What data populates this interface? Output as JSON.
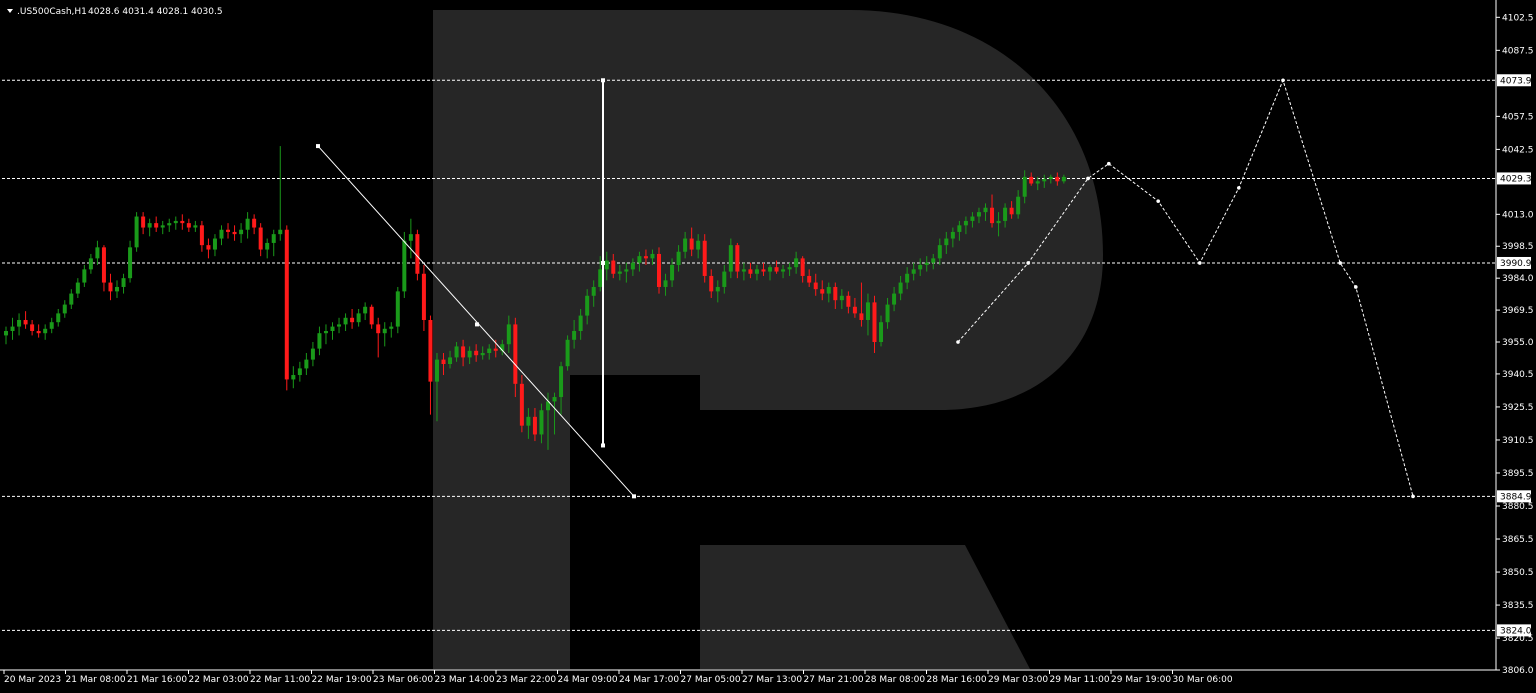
{
  "header": {
    "symbol": ".US500Cash,H1",
    "ohlc": "4028.6 4031.4 4028.1 4030.5"
  },
  "colors": {
    "background": "#000000",
    "foreground": "#ffffff",
    "bull": "#1a9a1a",
    "bear": "#ff1a1a",
    "watermark": "#262626"
  },
  "chart_data": {
    "type": "candlestick",
    "title": ".US500Cash,H1",
    "timeframe": "H1",
    "xlabel": "",
    "ylabel": "",
    "ylim": [
      3806.0,
      4109.0
    ],
    "grid": false,
    "y_ticks": [
      4102.5,
      4087.5,
      4057.5,
      4042.5,
      4013.0,
      3998.5,
      3984.0,
      3969.5,
      3955.0,
      3940.5,
      3925.5,
      3910.5,
      3895.5,
      3880.5,
      3865.5,
      3850.5,
      3835.5,
      3820.5,
      3806.0
    ],
    "x_ticks": [
      "20 Mar 2023",
      "21 Mar 08:00",
      "21 Mar 16:00",
      "22 Mar 03:00",
      "22 Mar 11:00",
      "22 Mar 19:00",
      "23 Mar 06:00",
      "23 Mar 14:00",
      "23 Mar 22:00",
      "24 Mar 09:00",
      "24 Mar 17:00",
      "27 Mar 05:00",
      "27 Mar 13:00",
      "27 Mar 21:00",
      "28 Mar 08:00",
      "28 Mar 16:00",
      "29 Mar 03:00",
      "29 Mar 11:00",
      "29 Mar 19:00",
      "30 Mar 06:00"
    ],
    "levels": [
      4073.9,
      4029.3,
      3990.9,
      3884.9,
      3824.0
    ],
    "candles": [
      [
        3958,
        3962,
        3954,
        3960
      ],
      [
        3960,
        3966,
        3956,
        3962
      ],
      [
        3962,
        3968,
        3958,
        3965
      ],
      [
        3965,
        3969,
        3961,
        3963
      ],
      [
        3963,
        3965,
        3958,
        3960
      ],
      [
        3960,
        3963,
        3957,
        3959
      ],
      [
        3959,
        3963,
        3956,
        3961
      ],
      [
        3961,
        3966,
        3959,
        3964
      ],
      [
        3964,
        3970,
        3962,
        3968
      ],
      [
        3968,
        3974,
        3966,
        3972
      ],
      [
        3972,
        3979,
        3970,
        3977
      ],
      [
        3977,
        3984,
        3975,
        3982
      ],
      [
        3982,
        3990,
        3980,
        3988
      ],
      [
        3988,
        3995,
        3986,
        3993
      ],
      [
        3993,
        4001,
        3990,
        3998
      ],
      [
        3998,
        3999,
        3978,
        3982
      ],
      [
        3982,
        3986,
        3974,
        3978
      ],
      [
        3978,
        3983,
        3975,
        3980
      ],
      [
        3980,
        3986,
        3977,
        3984
      ],
      [
        3984,
        4001,
        3982,
        3998
      ],
      [
        3998,
        4014,
        3996,
        4012
      ],
      [
        4012,
        4014,
        4004,
        4007
      ],
      [
        4007,
        4011,
        4003,
        4009
      ],
      [
        4009,
        4012,
        4005,
        4007
      ],
      [
        4007,
        4010,
        4004,
        4008
      ],
      [
        4008,
        4011,
        4005,
        4009
      ],
      [
        4009,
        4012,
        4006,
        4010
      ],
      [
        4010,
        4013,
        4006,
        4009
      ],
      [
        4009,
        4011,
        4005,
        4007
      ],
      [
        4007,
        4010,
        4005,
        4008
      ],
      [
        4008,
        4010,
        3996,
        3999
      ],
      [
        3999,
        4002,
        3993,
        3997
      ],
      [
        3997,
        4004,
        3994,
        4002
      ],
      [
        4002,
        4008,
        3999,
        4006
      ],
      [
        4006,
        4009,
        4002,
        4005
      ],
      [
        4005,
        4008,
        4001,
        4004
      ],
      [
        4004,
        4009,
        4000,
        4006
      ],
      [
        4006,
        4014,
        4002,
        4011
      ],
      [
        4011,
        4013,
        4004,
        4007
      ],
      [
        4007,
        4009,
        3994,
        3997
      ],
      [
        3997,
        4002,
        3993,
        4000
      ],
      [
        4000,
        4006,
        3994,
        4004
      ],
      [
        4004,
        4044,
        4001,
        4006
      ],
      [
        4006,
        4008,
        3933,
        3938
      ],
      [
        3938,
        3944,
        3934,
        3940
      ],
      [
        3940,
        3946,
        3937,
        3943
      ],
      [
        3943,
        3950,
        3940,
        3947
      ],
      [
        3947,
        3955,
        3944,
        3952
      ],
      [
        3952,
        3962,
        3949,
        3959
      ],
      [
        3959,
        3963,
        3954,
        3960
      ],
      [
        3960,
        3964,
        3956,
        3962
      ],
      [
        3962,
        3966,
        3959,
        3963
      ],
      [
        3963,
        3968,
        3960,
        3966
      ],
      [
        3966,
        3970,
        3961,
        3964
      ],
      [
        3964,
        3970,
        3962,
        3968
      ],
      [
        3968,
        3973,
        3965,
        3971
      ],
      [
        3971,
        3972,
        3961,
        3963
      ],
      [
        3963,
        3966,
        3948,
        3959
      ],
      [
        3959,
        3964,
        3953,
        3961
      ],
      [
        3961,
        3964,
        3957,
        3962
      ],
      [
        3962,
        3980,
        3959,
        3978
      ],
      [
        3978,
        4005,
        3975,
        4001
      ],
      [
        4001,
        4011,
        3993,
        4004
      ],
      [
        4004,
        4006,
        3983,
        3986
      ],
      [
        3986,
        3990,
        3960,
        3965
      ],
      [
        3965,
        3967,
        3922,
        3937
      ],
      [
        3937,
        3950,
        3919,
        3947
      ],
      [
        3947,
        3950,
        3940,
        3945
      ],
      [
        3945,
        3951,
        3943,
        3948
      ],
      [
        3948,
        3955,
        3946,
        3953
      ],
      [
        3953,
        3956,
        3944,
        3948
      ],
      [
        3948,
        3953,
        3945,
        3951
      ],
      [
        3951,
        3954,
        3946,
        3949
      ],
      [
        3949,
        3953,
        3947,
        3950
      ],
      [
        3950,
        3954,
        3947,
        3952
      ],
      [
        3952,
        3956,
        3948,
        3951
      ],
      [
        3951,
        3956,
        3949,
        3954
      ],
      [
        3954,
        3967,
        3950,
        3963
      ],
      [
        3963,
        3966,
        3930,
        3936
      ],
      [
        3936,
        3940,
        3914,
        3917
      ],
      [
        3917,
        3925,
        3911,
        3921
      ],
      [
        3921,
        3925,
        3910,
        3913
      ],
      [
        3913,
        3927,
        3909,
        3924
      ],
      [
        3924,
        3932,
        3906,
        3928
      ],
      [
        3928,
        3932,
        3913,
        3930
      ],
      [
        3930,
        3946,
        3922,
        3944
      ],
      [
        3944,
        3958,
        3942,
        3956
      ],
      [
        3956,
        3965,
        3952,
        3960
      ],
      [
        3960,
        3970,
        3956,
        3967
      ],
      [
        3967,
        3979,
        3963,
        3976
      ],
      [
        3976,
        3983,
        3971,
        3980
      ],
      [
        3980,
        3994,
        3978,
        3988
      ],
      [
        3988,
        3996,
        3983,
        3992
      ],
      [
        3992,
        3995,
        3984,
        3986
      ],
      [
        3986,
        3990,
        3983,
        3987
      ],
      [
        3987,
        3991,
        3982,
        3988
      ],
      [
        3988,
        3993,
        3985,
        3991
      ],
      [
        3991,
        3996,
        3987,
        3994
      ],
      [
        3994,
        3997,
        3990,
        3993
      ],
      [
        3993,
        3997,
        3990,
        3995
      ],
      [
        3995,
        3998,
        3977,
        3980
      ],
      [
        3980,
        3986,
        3976,
        3983
      ],
      [
        3983,
        3993,
        3980,
        3990
      ],
      [
        3990,
        3999,
        3987,
        3996
      ],
      [
        3996,
        4005,
        3993,
        4002
      ],
      [
        4002,
        4007,
        3994,
        3997
      ],
      [
        3997,
        4004,
        3993,
        4001
      ],
      [
        4001,
        4004,
        3982,
        3985
      ],
      [
        3985,
        3988,
        3975,
        3978
      ],
      [
        3978,
        3983,
        3973,
        3980
      ],
      [
        3980,
        3990,
        3977,
        3987
      ],
      [
        3987,
        4002,
        3984,
        3999
      ],
      [
        3999,
        4000,
        3984,
        3987
      ],
      [
        3987,
        3991,
        3983,
        3988
      ],
      [
        3988,
        3991,
        3984,
        3986
      ],
      [
        3986,
        3990,
        3983,
        3988
      ],
      [
        3988,
        3991,
        3985,
        3987
      ],
      [
        3987,
        3990,
        3983,
        3989
      ],
      [
        3989,
        3992,
        3986,
        3987
      ],
      [
        3987,
        3990,
        3984,
        3988
      ],
      [
        3988,
        3991,
        3985,
        3989
      ],
      [
        3989,
        3996,
        3986,
        3993
      ],
      [
        3993,
        3994,
        3982,
        3985
      ],
      [
        3985,
        3988,
        3980,
        3982
      ],
      [
        3982,
        3986,
        3976,
        3979
      ],
      [
        3979,
        3983,
        3974,
        3977
      ],
      [
        3977,
        3982,
        3973,
        3980
      ],
      [
        3980,
        3982,
        3970,
        3974
      ],
      [
        3974,
        3979,
        3970,
        3976
      ],
      [
        3976,
        3978,
        3968,
        3971
      ],
      [
        3971,
        3975,
        3966,
        3968
      ],
      [
        3968,
        3982,
        3962,
        3965
      ],
      [
        3965,
        3977,
        3958,
        3973
      ],
      [
        3973,
        3976,
        3950,
        3955
      ],
      [
        3955,
        3967,
        3953,
        3964
      ],
      [
        3964,
        3975,
        3961,
        3972
      ],
      [
        3972,
        3980,
        3969,
        3977
      ],
      [
        3977,
        3985,
        3974,
        3982
      ],
      [
        3982,
        3989,
        3979,
        3986
      ],
      [
        3986,
        3991,
        3983,
        3988
      ],
      [
        3988,
        3993,
        3985,
        3990
      ],
      [
        3990,
        3994,
        3987,
        3991
      ],
      [
        3991,
        3995,
        3988,
        3993
      ],
      [
        3993,
        4002,
        3990,
        3999
      ],
      [
        3999,
        4005,
        3995,
        4002
      ],
      [
        4002,
        4007,
        3998,
        4005
      ],
      [
        4005,
        4010,
        4001,
        4008
      ],
      [
        4008,
        4012,
        4004,
        4010
      ],
      [
        4010,
        4014,
        4007,
        4012
      ],
      [
        4012,
        4016,
        4009,
        4014
      ],
      [
        4014,
        4018,
        4010,
        4016
      ],
      [
        4016,
        4022,
        4007,
        4009
      ],
      [
        4009,
        4014,
        4003,
        4010
      ],
      [
        4010,
        4018,
        4007,
        4016
      ],
      [
        4016,
        4019,
        4011,
        4013
      ],
      [
        4013,
        4024,
        4011,
        4021
      ],
      [
        4021,
        4033,
        4018,
        4030
      ],
      [
        4030,
        4032,
        4026,
        4027
      ],
      [
        4027,
        4030,
        4024,
        4028
      ],
      [
        4028,
        4031,
        4025,
        4029
      ],
      [
        4029,
        4031,
        4027,
        4030
      ],
      [
        4030,
        4032,
        4026,
        4028
      ],
      [
        4028,
        4031,
        4027,
        4030
      ]
    ],
    "forecast_path": [
      [
        0,
        3955
      ],
      [
        0.27,
        3990.9
      ],
      [
        0.5,
        4029.3
      ],
      [
        0.58,
        4036
      ],
      [
        0.77,
        4019
      ],
      [
        0.93,
        3990.9
      ],
      [
        1.08,
        4025
      ],
      [
        1.25,
        4073.9
      ],
      [
        1.47,
        3990.9
      ],
      [
        1.53,
        3980
      ],
      [
        1.75,
        3884.9
      ]
    ],
    "past_wave": [
      [
        4044,
        3884.9
      ],
      [
        4073.9,
        3908
      ]
    ]
  }
}
